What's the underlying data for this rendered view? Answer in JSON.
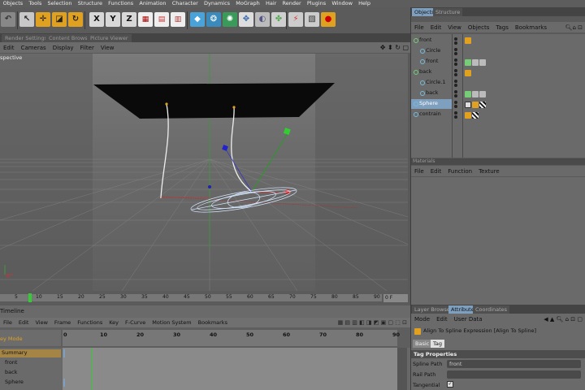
{
  "menubar": {
    "items": [
      "Objects",
      "Tools",
      "Selection",
      "Structure",
      "Functions",
      "Animation",
      "Character",
      "Dynamics",
      "MoGraph",
      "Hair",
      "Render",
      "Plugins",
      "Window",
      "Help"
    ]
  },
  "toolbar": {
    "x_label": "X",
    "y_label": "Y",
    "z_label": "Z"
  },
  "tabs": [
    "Render Settings",
    "Content Browser",
    "Picture Viewer"
  ],
  "viewport": {
    "menu": [
      "Edit",
      "Cameras",
      "Display",
      "Filter",
      "View"
    ],
    "label": "spective"
  },
  "ruler": {
    "ticks": [
      "5",
      "10",
      "15",
      "20",
      "25",
      "30",
      "35",
      "40",
      "45",
      "50",
      "55",
      "60",
      "65",
      "70",
      "75",
      "80",
      "85",
      "90"
    ],
    "frame": "0 F"
  },
  "timeline": {
    "title": "Timeline",
    "menu": [
      "File",
      "Edit",
      "View",
      "Frame",
      "Functions",
      "Key",
      "F-Curve",
      "Motion System",
      "Bookmarks"
    ],
    "mode": "ey Mode",
    "ticks": [
      "0",
      "10",
      "20",
      "30",
      "40",
      "50",
      "60",
      "70",
      "80",
      "90"
    ],
    "rows": [
      "Summary",
      "front",
      "back",
      "Sphere"
    ]
  },
  "objects_panel": {
    "tabs": [
      "Objects",
      "Structure"
    ],
    "menu": [
      "File",
      "Edit",
      "View",
      "Objects",
      "Tags",
      "Bookmarks"
    ],
    "rows": [
      "front",
      "Circle",
      "front",
      "back",
      "Circle.1",
      "back",
      "Sphere",
      "contrain"
    ]
  },
  "materials_panel": {
    "title": "Materials",
    "menu": [
      "File",
      "Edit",
      "Function",
      "Texture"
    ]
  },
  "attributes_panel": {
    "tabs": [
      "Layer Browser",
      "Attributes",
      "Coordinates"
    ],
    "menu": [
      "Mode",
      "Edit",
      "User Data"
    ],
    "expression": "Align To Spline Expression [Align To Spline]",
    "subtabs": [
      "Basic",
      "Tag"
    ],
    "section": "Tag Properties",
    "fields": [
      {
        "label": "Spline Path",
        "value": "front"
      },
      {
        "label": "Rail Path",
        "value": ""
      },
      {
        "label": "Tangential",
        "value": ""
      }
    ]
  },
  "colors": {
    "accent": "#e0a020",
    "selected": "#7f9fbf",
    "gray_bg": "#595959"
  }
}
